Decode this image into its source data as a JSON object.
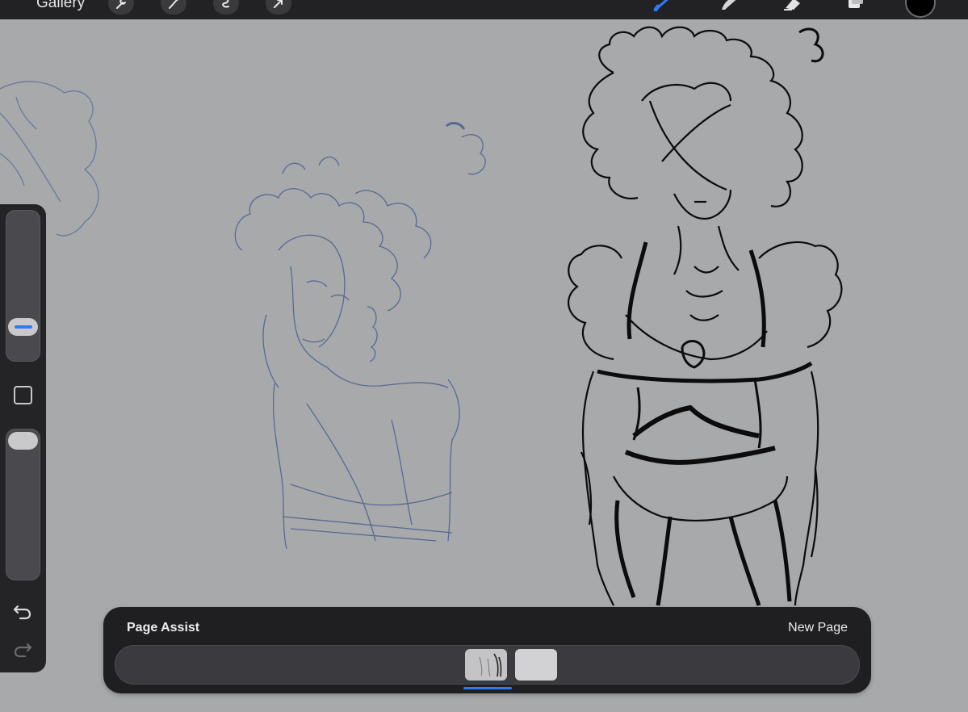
{
  "topbar": {
    "gallery_label": "Gallery",
    "left_tools": [
      "wrench-icon",
      "magic-wand-icon",
      "selection-icon",
      "transform-icon"
    ],
    "right_tools": [
      "brush-icon",
      "smudge-icon",
      "eraser-icon",
      "layers-icon"
    ],
    "active_tool": "brush-icon",
    "active_color": "#000000",
    "accent_color": "#2f7bf5"
  },
  "sidebar": {
    "size_slider_level": 0.27,
    "opacity_slider_level": 1.0
  },
  "page_assist": {
    "title": "Page Assist",
    "new_page_label": "New Page",
    "current_page": 1
  }
}
